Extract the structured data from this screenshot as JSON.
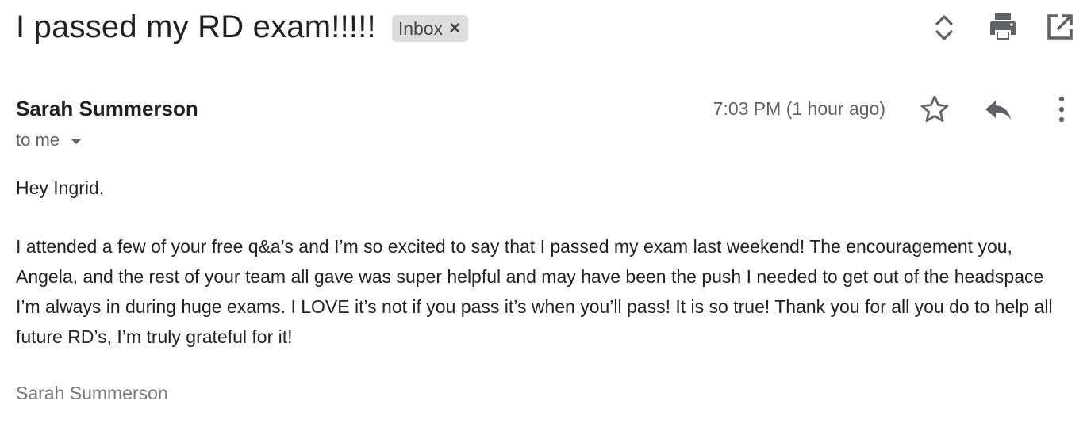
{
  "email": {
    "subject": "I passed my RD exam!!!!!",
    "label": "Inbox",
    "label_remove": "×",
    "sender": "Sarah Summerson",
    "recipient": "to me",
    "timestamp": "7:03 PM (1 hour ago)",
    "greeting": "Hey Ingrid,",
    "body": "I attended a few of your free q&a’s and I’m so excited to say that I passed my exam last weekend! The encouragement you, Angela, and the rest of your team all gave was super helpful and may have been the push I needed to get out of the headspace I’m always in during huge exams. I LOVE it’s not if you pass it’s when you’ll pass! It is so true! Thank you for all you do to help all future RD’s, I’m truly grateful for it!",
    "signature": "Sarah Summerson"
  },
  "icons": {
    "toolbar": [
      "expand-collapse-icon",
      "print-icon",
      "open-in-new-window-icon"
    ],
    "message": [
      "star-icon",
      "reply-icon",
      "more-options-icon"
    ]
  },
  "colors": {
    "icon": "#5f6368",
    "chip_background": "#dddddd",
    "text": "#222222",
    "muted_text": "#5f6368",
    "signature_text": "#777777"
  }
}
